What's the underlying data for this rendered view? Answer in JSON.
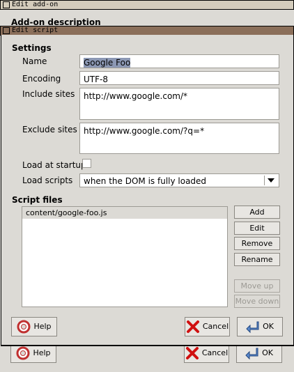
{
  "back_window": {
    "title": "Edit add-on",
    "description_heading": "Add-on description",
    "help_label": "Help",
    "cancel_label": "Cancel",
    "ok_label": "OK"
  },
  "dialog": {
    "title": "Edit script",
    "settings_heading": "Settings",
    "name_label": "Name",
    "name_value": "Google Foo",
    "encoding_label": "Encoding",
    "encoding_value": "UTF-8",
    "include_label": "Include sites",
    "include_value": "http://www.google.com/*",
    "exclude_label": "Exclude sites",
    "exclude_value": "http://www.google.com/?q=*",
    "startup_label": "Load at startup",
    "load_scripts_label": "Load scripts",
    "load_scripts_value": "when the DOM is fully loaded",
    "script_files_heading": "Script files",
    "script_files": [
      "content/google-foo.js"
    ],
    "add_label": "Add",
    "edit_label": "Edit",
    "remove_label": "Remove",
    "rename_label": "Rename",
    "move_up_label": "Move up",
    "move_down_label": "Move down",
    "help_label": "Help",
    "cancel_label": "Cancel",
    "ok_label": "OK"
  }
}
